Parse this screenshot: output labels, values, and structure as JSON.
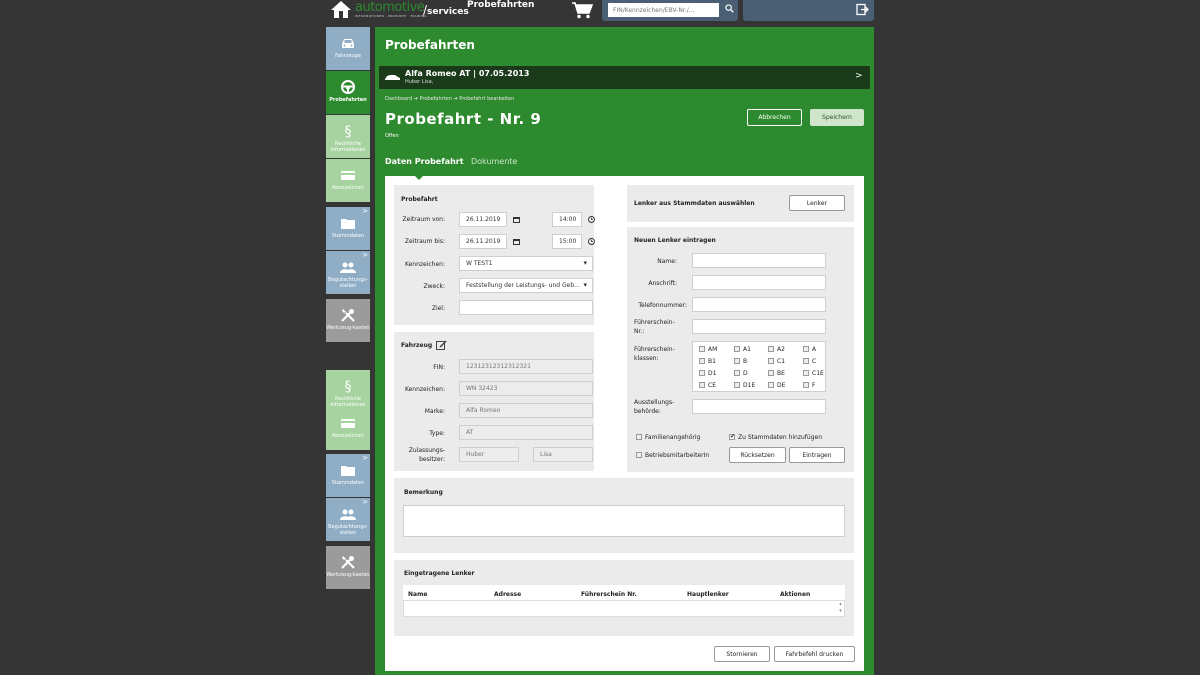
{
  "header": {
    "logo_main": "automotive",
    "logo_services": "services",
    "logo_sub": "INFORMATIONEN · PRODUKTE · TRAINING",
    "page_title": "Probefahrten",
    "search_placeholder": "FIN/Kennzeichen/EBV-Nr./...",
    "search_icon": "magnifier-icon",
    "cart_icon": "cart-icon",
    "logout_icon": "logout-icon"
  },
  "sidebar": {
    "items": [
      {
        "label": "Fahrzeuge",
        "icon": "car-icon"
      },
      {
        "label": "Probefahrten",
        "icon": "steering-wheel-icon"
      },
      {
        "label": "Rechtliche Informationen",
        "icon": "paragraph-icon"
      },
      {
        "label": "Kennzeichen",
        "icon": "plate-icon"
      },
      {
        "label": "Stammdaten",
        "icon": "folder-icon",
        "arrow": ">"
      },
      {
        "label": "Begutachtungs-stellen",
        "icon": "people-icon",
        "arrow": ">"
      },
      {
        "label": "Werkzeug-kasten",
        "icon": "tools-icon"
      },
      {
        "label": "Rechtliche Informationen",
        "icon": "paragraph-icon"
      },
      {
        "label": "Kennzeichen",
        "icon": "plate-icon"
      },
      {
        "label": "Stammdaten",
        "icon": "folder-icon",
        "arrow": ">"
      },
      {
        "label": "Begutachtungs-stellen",
        "icon": "people-icon",
        "arrow": ">"
      },
      {
        "label": "Werkzeug-kasten",
        "icon": "tools-icon"
      }
    ]
  },
  "main": {
    "section_title": "Probefahrten",
    "vehicle": {
      "name": "Alfa Romeo AT | 07.05.2013",
      "owner": "Huber Lisa,",
      "arrow": ">"
    },
    "breadcrumb": "Dashboard ➔ Probefahrten ➔ Probefahrt bearbeiten",
    "title": "Probefahrt - Nr. 9",
    "status": "Offen",
    "btn_cancel": "Abbrechen",
    "btn_save": "Speichern",
    "tabs": [
      "Daten Probefahrt",
      "Dokumente"
    ]
  },
  "probefahrt": {
    "heading": "Probefahrt",
    "from_label": "Zeitraum von:",
    "from_date": "26.11.2019",
    "from_time": "14:00",
    "to_label": "Zeitraum bis:",
    "to_date": "26.11.2019",
    "to_time": "15:00",
    "plate_label": "Kennzeichen:",
    "plate_value": "W TEST1",
    "purpose_label": "Zweck:",
    "purpose_value": "Feststellung der Leistungs- und Geb...",
    "goal_label": "Ziel:",
    "goal_value": ""
  },
  "fahrzeug": {
    "heading": "Fahrzeug",
    "fin_label": "FIN:",
    "fin_value": "12312312312312321",
    "plate_label": "Kennzeichen:",
    "plate_value": "WN 32423",
    "brand_label": "Marke:",
    "brand_value": "Alfa Romeo",
    "type_label": "Type:",
    "type_value": "AT",
    "holder_label": "Zulassungs-besitzer:",
    "holder_last": "Huber",
    "holder_first": "Lisa"
  },
  "lenker": {
    "select_text": "Lenker aus Stammdaten auswählen",
    "select_btn": "Lenker",
    "new_heading": "Neuen Lenker eintragen",
    "name_label": "Name:",
    "address_label": "Anschrift:",
    "phone_label": "Telefonnummer:",
    "license_no_label": "Führerschein-Nr.:",
    "license_class_label": "Führerschein-klassen:",
    "classes": [
      "AM",
      "A1",
      "A2",
      "A",
      "B1",
      "B",
      "C1",
      "C",
      "D1",
      "D",
      "BE",
      "C1E",
      "CE",
      "D1E",
      "DE",
      "F"
    ],
    "authority_label": "Ausstellungs-behörde:",
    "family_label": "Familienangehörig",
    "employee_label": "BetriebsmitarbeiterIn",
    "add_master_label": "Zu Stammdaten hinzufügen",
    "reset_btn": "Rücksetzen",
    "enter_btn": "Eintragen"
  },
  "bemerkung": {
    "heading": "Bemerkung",
    "value": ""
  },
  "eingetragene": {
    "heading": "Eingetragene Lenker",
    "columns": [
      "Name",
      "Adresse",
      "Führerschein Nr.",
      "Hauptlenker",
      "Aktionen"
    ]
  },
  "footer": {
    "cancel_btn": "Stornieren",
    "print_btn": "Fahrbefehl drucken"
  }
}
